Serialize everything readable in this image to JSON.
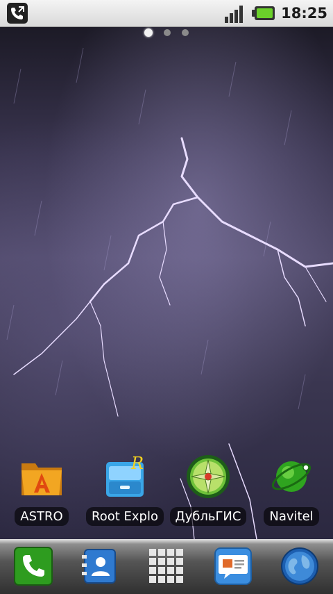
{
  "status_bar": {
    "time": "18:25",
    "icons": [
      "phone-in-call-icon",
      "signal-icon",
      "battery-icon"
    ]
  },
  "home": {
    "page_count": 3,
    "active_page": 1,
    "apps": [
      {
        "label": "ASTRO",
        "icon": "astro-folder-icon"
      },
      {
        "label": "Root Explo",
        "icon": "root-explorer-icon"
      },
      {
        "label": "ДубльГИС",
        "icon": "dublgis-compass-icon"
      },
      {
        "label": "Navitel",
        "icon": "navitel-globe-icon"
      }
    ]
  },
  "dock": {
    "items": [
      "phone-icon",
      "contacts-icon",
      "app-drawer-icon",
      "messaging-icon",
      "browser-icon"
    ]
  },
  "colors": {
    "status_bar_bg": "#e6e6e6",
    "battery_green": "#6bd12a",
    "phone_green": "#2e9c1f"
  }
}
